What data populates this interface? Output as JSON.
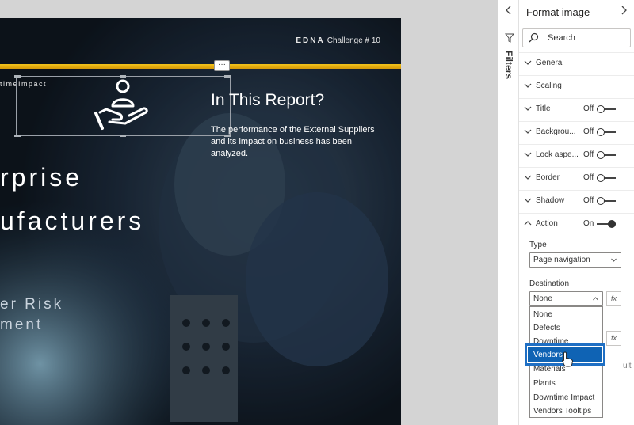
{
  "report": {
    "brand": "EDNA",
    "challenge": "Challenge # 10",
    "small_tag": "timeImpact",
    "more_label": "···",
    "question": "In This Report?",
    "description": "The performance of the External Suppliers and its impact on business has been analyzed.",
    "title_line1": "rprise",
    "title_line2": "ufacturers",
    "subtitle_line1": "er Risk",
    "subtitle_line2": "ment",
    "accent_color": "#f0b913"
  },
  "filters": {
    "label": "Filters",
    "collapse_icon": "chevron-left-icon",
    "filter_icon": "funnel-icon"
  },
  "pane": {
    "title": "Format image",
    "close_icon": "chevron-right-icon",
    "search_placeholder": "Search",
    "sections": [
      {
        "label": "General"
      },
      {
        "label": "Scaling"
      },
      {
        "label": "Title",
        "state": "Off"
      },
      {
        "label": "Backgrou...",
        "state": "Off"
      },
      {
        "label": "Lock aspe...",
        "state": "Off"
      },
      {
        "label": "Border",
        "state": "Off"
      },
      {
        "label": "Shadow",
        "state": "Off"
      },
      {
        "label": "Action",
        "state": "On",
        "expanded": true
      }
    ],
    "action": {
      "type_label": "Type",
      "type_value": "Page navigation",
      "destination_label": "Destination",
      "destination_value": "None",
      "fx_label": "fx",
      "options": [
        "None",
        "Defects",
        "Downtime",
        "Vendors",
        "Materials",
        "Plants",
        "Downtime Impact",
        "Vendors Tooltips"
      ],
      "highlighted_option": "Vendors",
      "partial_right_text": "ult"
    }
  }
}
